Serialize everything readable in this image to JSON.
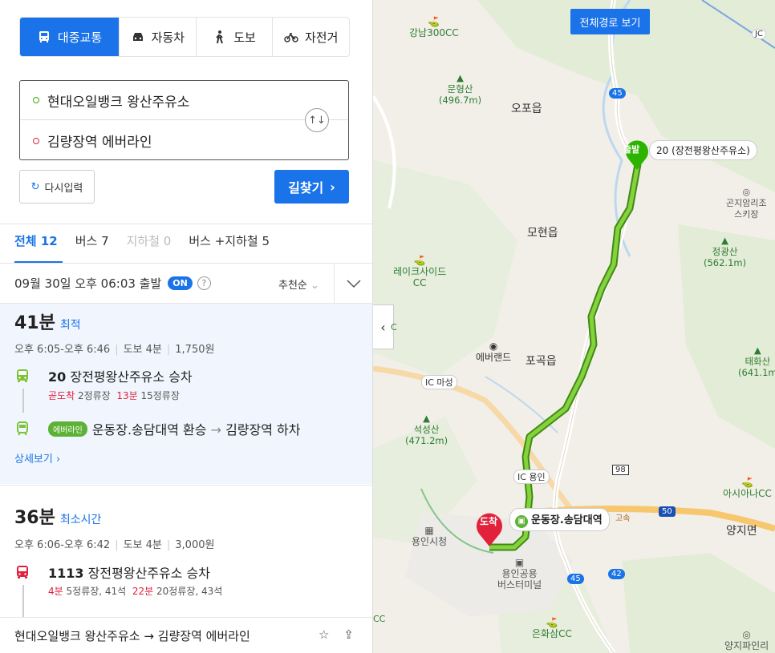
{
  "modes": [
    {
      "label": "대중교통",
      "icon": "bus-icon",
      "active": true
    },
    {
      "label": "자동차",
      "icon": "car-icon",
      "active": false
    },
    {
      "label": "도보",
      "icon": "walk-icon",
      "active": false
    },
    {
      "label": "자전거",
      "icon": "bike-icon",
      "active": false
    }
  ],
  "route": {
    "origin": "현대오일뱅크 왕산주유소",
    "destination": "김량장역 에버라인"
  },
  "buttons": {
    "reset": "다시입력",
    "search": "길찾기"
  },
  "tabs": [
    {
      "label": "전체 12",
      "state": "active"
    },
    {
      "label": "버스 7",
      "state": "normal"
    },
    {
      "label": "지하철 0",
      "state": "disabled"
    },
    {
      "label": "버스 +지하철 5",
      "state": "normal"
    }
  ],
  "depart": {
    "text": "09월 30일 오후 06:03 출발",
    "on": "ON",
    "help": "?",
    "sort": "추천순"
  },
  "result1": {
    "duration": "41분",
    "tag": "최적",
    "time_range": "오후 6:05-오후 6:46",
    "walk": "도보 4분",
    "fare": "1,750원",
    "step1_line": "20",
    "step1_stop": "장전평왕산주유소 승차",
    "step1_sub_a_red": "곧도착",
    "step1_sub_a": "2정류장",
    "step1_sub_b_red": "13분",
    "step1_sub_b": "15정류장",
    "step2_badge": "에버라인",
    "step2_text": "운동장.송담대역 환승",
    "step2_arrow": "→",
    "step2_text2": "김량장역 하차",
    "detail": "상세보기"
  },
  "result2": {
    "duration": "36분",
    "tag": "최소시간",
    "time_range": "오후 6:06-오후 6:42",
    "walk": "도보 4분",
    "fare": "3,000원",
    "step1_line": "1113",
    "step1_stop": "장전평왕산주유소 승차",
    "step1_sub_a_red": "4분",
    "step1_sub_a": "5정류장, 41석",
    "step1_sub_b_red": "22분",
    "step1_sub_b": "20정류장, 43석"
  },
  "footer": {
    "text": "현대오일뱅크 왕산주유소 → 김량장역 에버라인"
  },
  "map": {
    "full_route_button": "전체경로 보기",
    "start_badge": "출발",
    "start_label": "20 (장전평왕산주유소)",
    "end_badge": "도착",
    "end_label": "운동장.송담대역",
    "labels": {
      "gangnam_cc": "강남300CC",
      "munhyeong": "문형산\n(496.7m)",
      "opo": "오포읍",
      "mohyeon": "모현읍",
      "lakeside": "레이크사이드\nCC",
      "everland": "에버랜드",
      "pogok": "포곡읍",
      "seokseong": "석성산\n(471.2m)",
      "jeonggwang": "정광산\n(562.1m)",
      "gonjiam": "곤지암리조\n스키장",
      "taehwa": "태화산\n(641.1m",
      "asiana": "아시아나CC",
      "yangji": "양지면",
      "yongin_city": "용인시청",
      "yongin_terminal": "용인공용\n버스터미널",
      "eunhwasam": "은화삼CC",
      "yangjipine": "양지파인리",
      "masung_ic": "마성",
      "yongin_ic": "용인",
      "r45a": "45",
      "r45b": "45",
      "r42": "42",
      "r98": "98",
      "r50": "50",
      "highway": "고속",
      "jc": "JC",
      "cc_left": "CC",
      "c_left": "C"
    }
  },
  "colors": {
    "accent": "#1a73e8",
    "route_green": "#7cc436",
    "start_pin": "#2db400",
    "end_pin": "#e2213b"
  }
}
